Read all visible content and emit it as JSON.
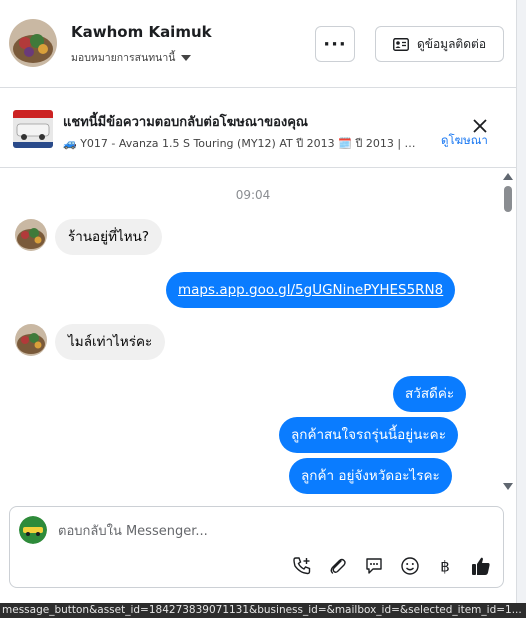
{
  "header": {
    "contact_name": "Kawhom Kaimuk",
    "assign_label": "มอบหมายการสนทนานี้",
    "more_label": "···",
    "contact_info_label": "ดูข้อมูลติดต่อ"
  },
  "ad": {
    "title": "แชทนี้มีข้อความตอบกลับต่อโฆษณาของคุณ",
    "subtitle": "🚙 Y017 - Avanza 1.5 S Touring (MY12) AT ปี 2013 🗓️ ปี 2013 | ⚙️ เ...",
    "view_ad_label": "ดูโฆษณา"
  },
  "conversation": {
    "timestamp": "09:04",
    "messages": [
      {
        "direction": "in",
        "text": "ร้านอยู่ที่ไหน?"
      },
      {
        "direction": "out",
        "text": "maps.app.goo.gl/5gUGNinePYHES5RN8",
        "is_link": true
      },
      {
        "direction": "in",
        "text": "ไมล์เท่าไหร่คะ"
      },
      {
        "direction": "out",
        "text": "สวัสดีค่ะ"
      },
      {
        "direction": "out",
        "text": "ลูกค้าสนใจรถรุ่นนี้อยู่นะคะ"
      },
      {
        "direction": "out",
        "text": "ลูกค้า  อยู่จังหวัดอะไรคะ"
      }
    ]
  },
  "composer": {
    "placeholder": "ตอบกลับใน Messenger...",
    "tools": [
      "phone-plus-icon",
      "paperclip-icon",
      "saved-reply-icon",
      "emoji-icon",
      "baht-icon",
      "thumbs-up-icon"
    ]
  },
  "status_bar": {
    "url": "message_button&asset_id=184273839071131&business_id=&mailbox_id=&selected_item_id=1..."
  },
  "colors": {
    "accent": "#0a7cff",
    "link": "#1877f2",
    "incoming_bubble": "#f0f0f0"
  }
}
